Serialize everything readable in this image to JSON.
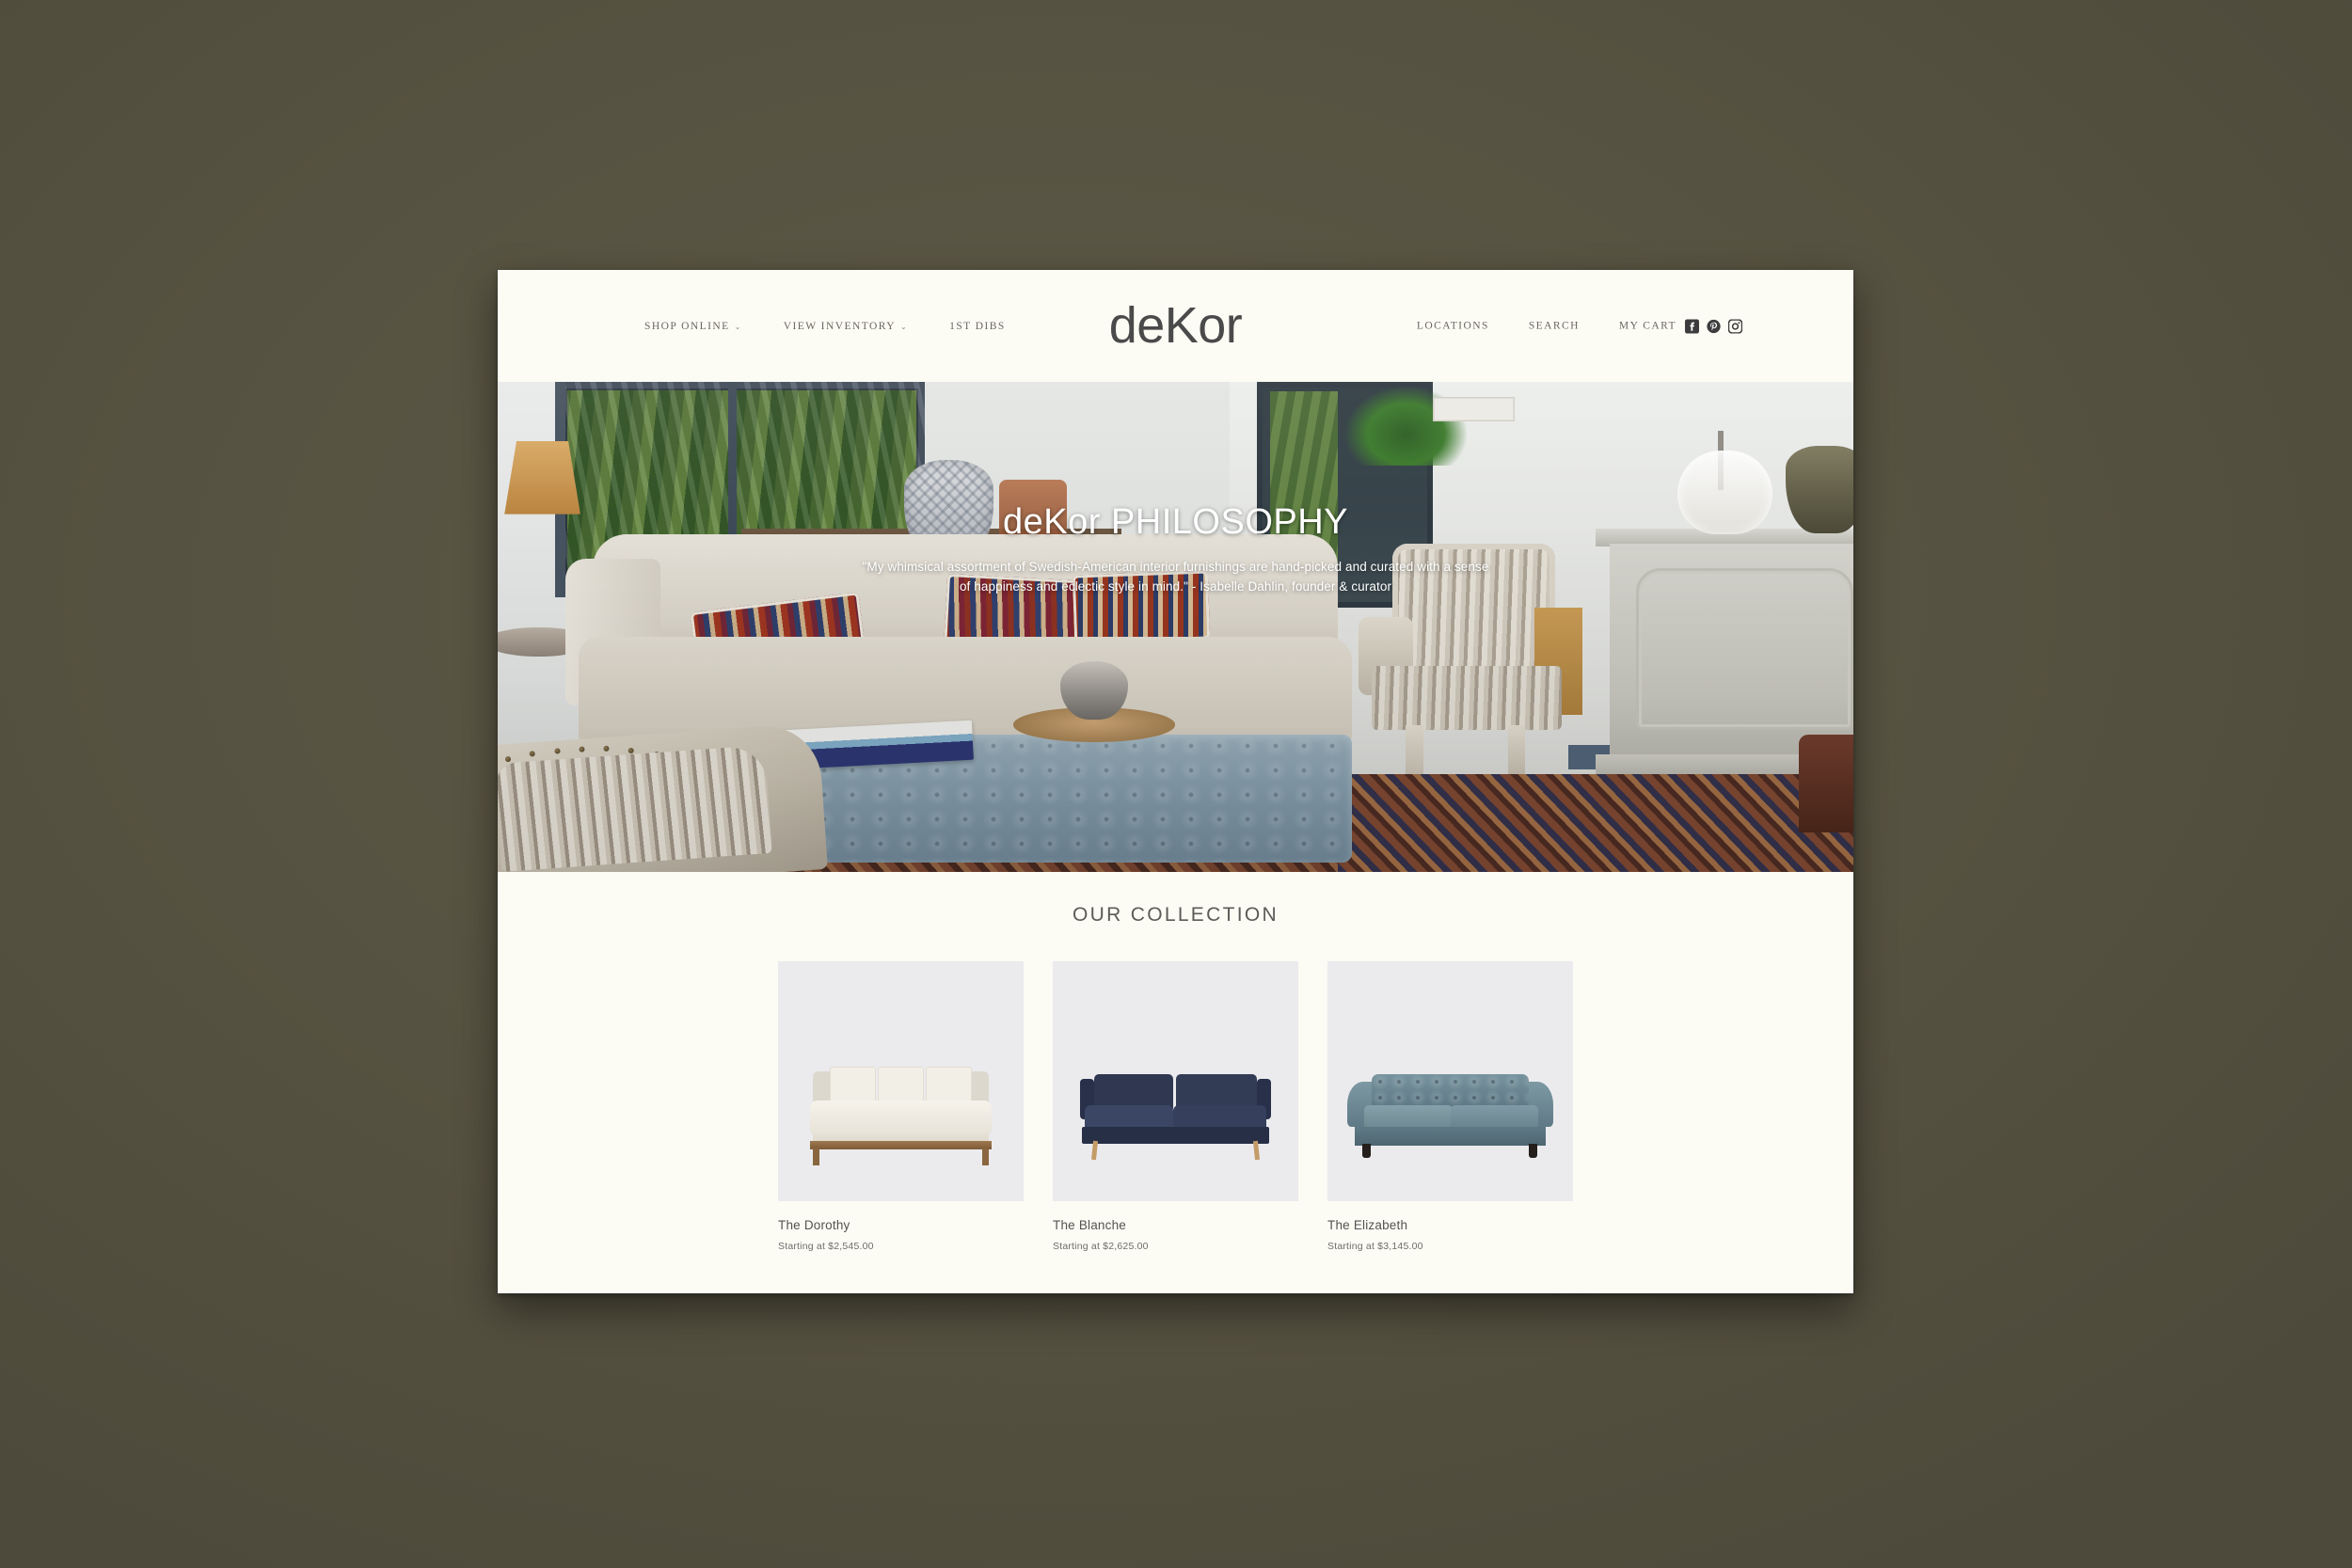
{
  "site": {
    "logo": "deKor",
    "background_color": "#585443",
    "page_background": "#fcfbf4"
  },
  "header": {
    "nav_left": [
      {
        "label": "SHOP ONLINE",
        "has_dropdown": true,
        "caret": "⌄"
      },
      {
        "label": "VIEW INVENTORY",
        "has_dropdown": true,
        "caret": "⌄"
      },
      {
        "label": "1ST DIBS",
        "has_dropdown": false,
        "caret": ""
      }
    ],
    "nav_right": [
      {
        "label": "LOCATIONS"
      },
      {
        "label": "SEARCH"
      },
      {
        "label": "MY CART"
      }
    ],
    "social": [
      {
        "name": "facebook-icon"
      },
      {
        "name": "pinterest-icon"
      },
      {
        "name": "instagram-icon"
      }
    ]
  },
  "hero": {
    "title_brand": "deKor",
    "title_rest": "PHILOSOPHY",
    "quote_line1": "\"My whimsical assortment of Swedish-American interior furnishings are hand-picked and curated with a sense",
    "quote_line2": "of happiness and eclectic style in mind.\" - Isabelle Dahlin, founder & curator"
  },
  "collection": {
    "title": "OUR COLLECTION",
    "products": [
      {
        "name": "The Dorothy",
        "price": "Starting at $2,545.00",
        "swatch": "#f2efe7"
      },
      {
        "name": "The Blanche",
        "price": "Starting at $2,625.00",
        "swatch": "#2f3850"
      },
      {
        "name": "The Elizabeth",
        "price": "Starting at $3,145.00",
        "swatch": "#77939e"
      }
    ]
  }
}
